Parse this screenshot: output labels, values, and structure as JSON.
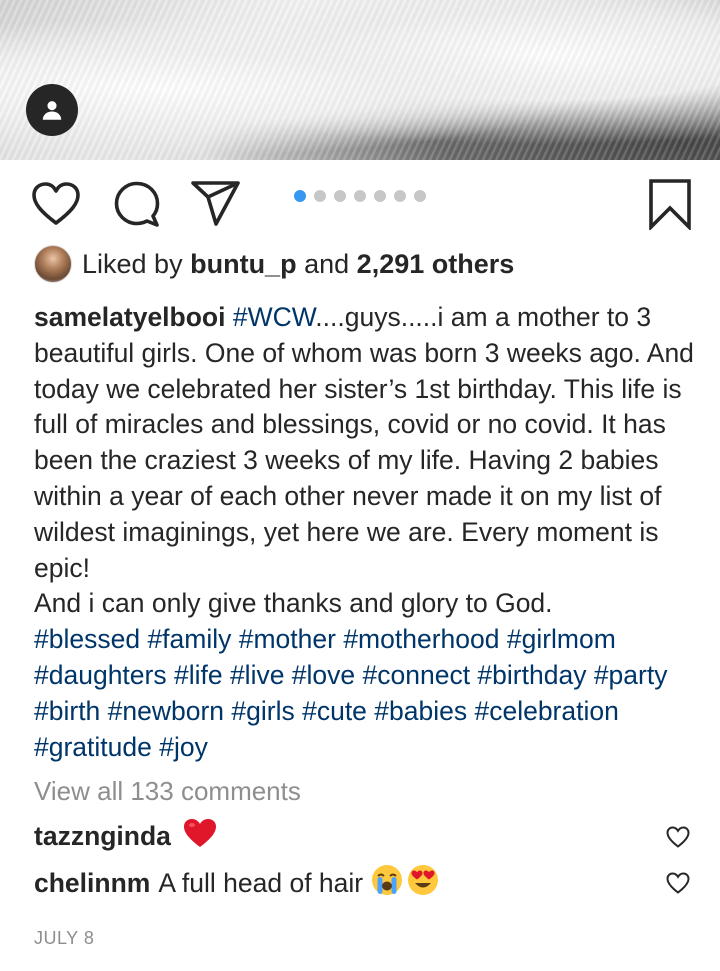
{
  "post": {
    "liked_by_prefix": "Liked by",
    "liked_by_user": "buntu_p",
    "liked_by_and": "and",
    "liked_by_others": "2,291 others",
    "carousel": {
      "total": 7,
      "active_index": 0
    },
    "caption": {
      "username": "samelatyelbooi",
      "hashtag_wcw": "#WCW",
      "text": "....guys.....i am a mother to 3 beautiful girls. One of whom was born 3 weeks ago. And today we celebrated her sister’s 1st birthday. This life is full of miracles and blessings, covid or no covid. It has been the craziest 3 weeks of my life. Having 2 babies within a year of each other never made it on my list of wildest imaginings, yet here we are. Every moment is epic!",
      "text2": "And i can only give thanks and glory to God.",
      "hashtags": "#blessed #family #mother #motherhood #girlmom #daughters #life #live #love #connect #birthday #party #birth #newborn #girls #cute #babies #celebration #gratitude #joy"
    },
    "view_all_comments": "View all 133 comments",
    "comments": [
      {
        "username": "tazznginda",
        "text": "",
        "emojis": "❤️"
      },
      {
        "username": "chelinnm",
        "text": "A full head of hair",
        "emojis": "😭😍"
      }
    ],
    "date": "JULY 8"
  },
  "colors": {
    "active_dot": "#3897f0",
    "hashtag": "#003569",
    "secondary_text": "#8e8e8e"
  },
  "icons": [
    "user-tag-icon",
    "heart-icon",
    "comment-icon",
    "share-icon",
    "bookmark-icon"
  ]
}
